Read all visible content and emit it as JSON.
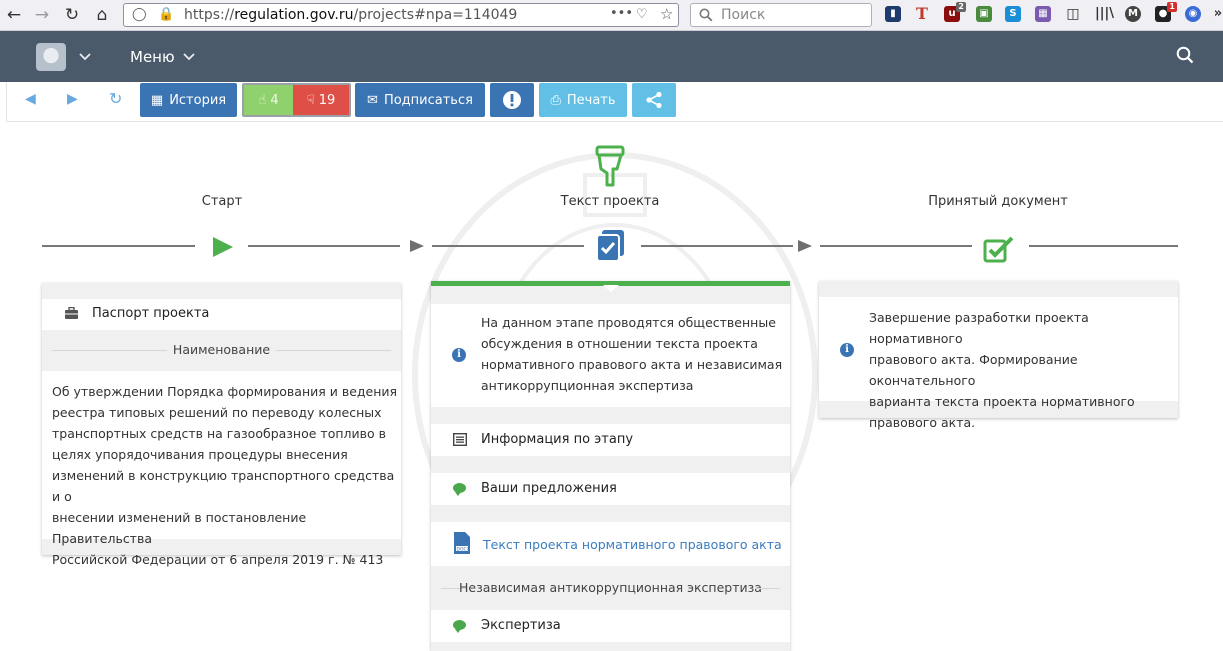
{
  "browser": {
    "url_prefix": "https://",
    "url_domain": "regulation.gov.ru",
    "url_path": "/projects#npa=114049",
    "menu_dots": "•••",
    "search_placeholder": "Поиск",
    "ext_badge_1": "2",
    "ext_badge_2": "1"
  },
  "header": {
    "menu_label": "Меню"
  },
  "toolbar": {
    "history_label": "История",
    "likes": "4",
    "dislikes": "19",
    "subscribe_label": "Подписаться",
    "print_label": "Печать"
  },
  "stages": [
    {
      "title": "Старт"
    },
    {
      "title": "Текст проекта"
    },
    {
      "title": "Принятый документ"
    }
  ],
  "card_start": {
    "passport_label": "Паспорт проекта",
    "name_header": "Наименование",
    "name_text_lines": [
      "Об утверждении Порядка формирования и ведения",
      "реестра типовых решений по переводу колесных",
      "транспортных средств на газообразное топливо в",
      "целях упорядочивания процедуры внесения",
      "изменений в конструкцию транспортного средства и о",
      "внесении изменений в постановление Правительства",
      "Российской Федерации от 6 апреля 2019 г. № 413"
    ]
  },
  "card_text": {
    "info_lines": [
      "На данном этапе проводятся общественные",
      "обсуждения в отношении текста проекта",
      "нормативного правового акта и независимая",
      "антикоррупционная экспертиза"
    ],
    "stage_info_label": "Информация по этапу",
    "proposals_label": "Ваши предложения",
    "project_text_link": "Текст проекта нормативного правового акта",
    "anticorruption_header": "Независимая антикоррупционная экспертиза",
    "expertise_label": "Экспертиза"
  },
  "card_accepted": {
    "info_lines": [
      "Завершение разработки проекта нормативного",
      "правового акта. Формирование окончательного",
      "варианта текста проекта нормативного",
      "правового акта."
    ]
  },
  "colors": {
    "header_bg": "#4b5a6b",
    "btn_blue": "#3b74b3",
    "btn_light": "#62c0e6",
    "like_green": "#8fd16d",
    "dislike_red": "#de4f47",
    "stage_green": "#4cb04c"
  }
}
